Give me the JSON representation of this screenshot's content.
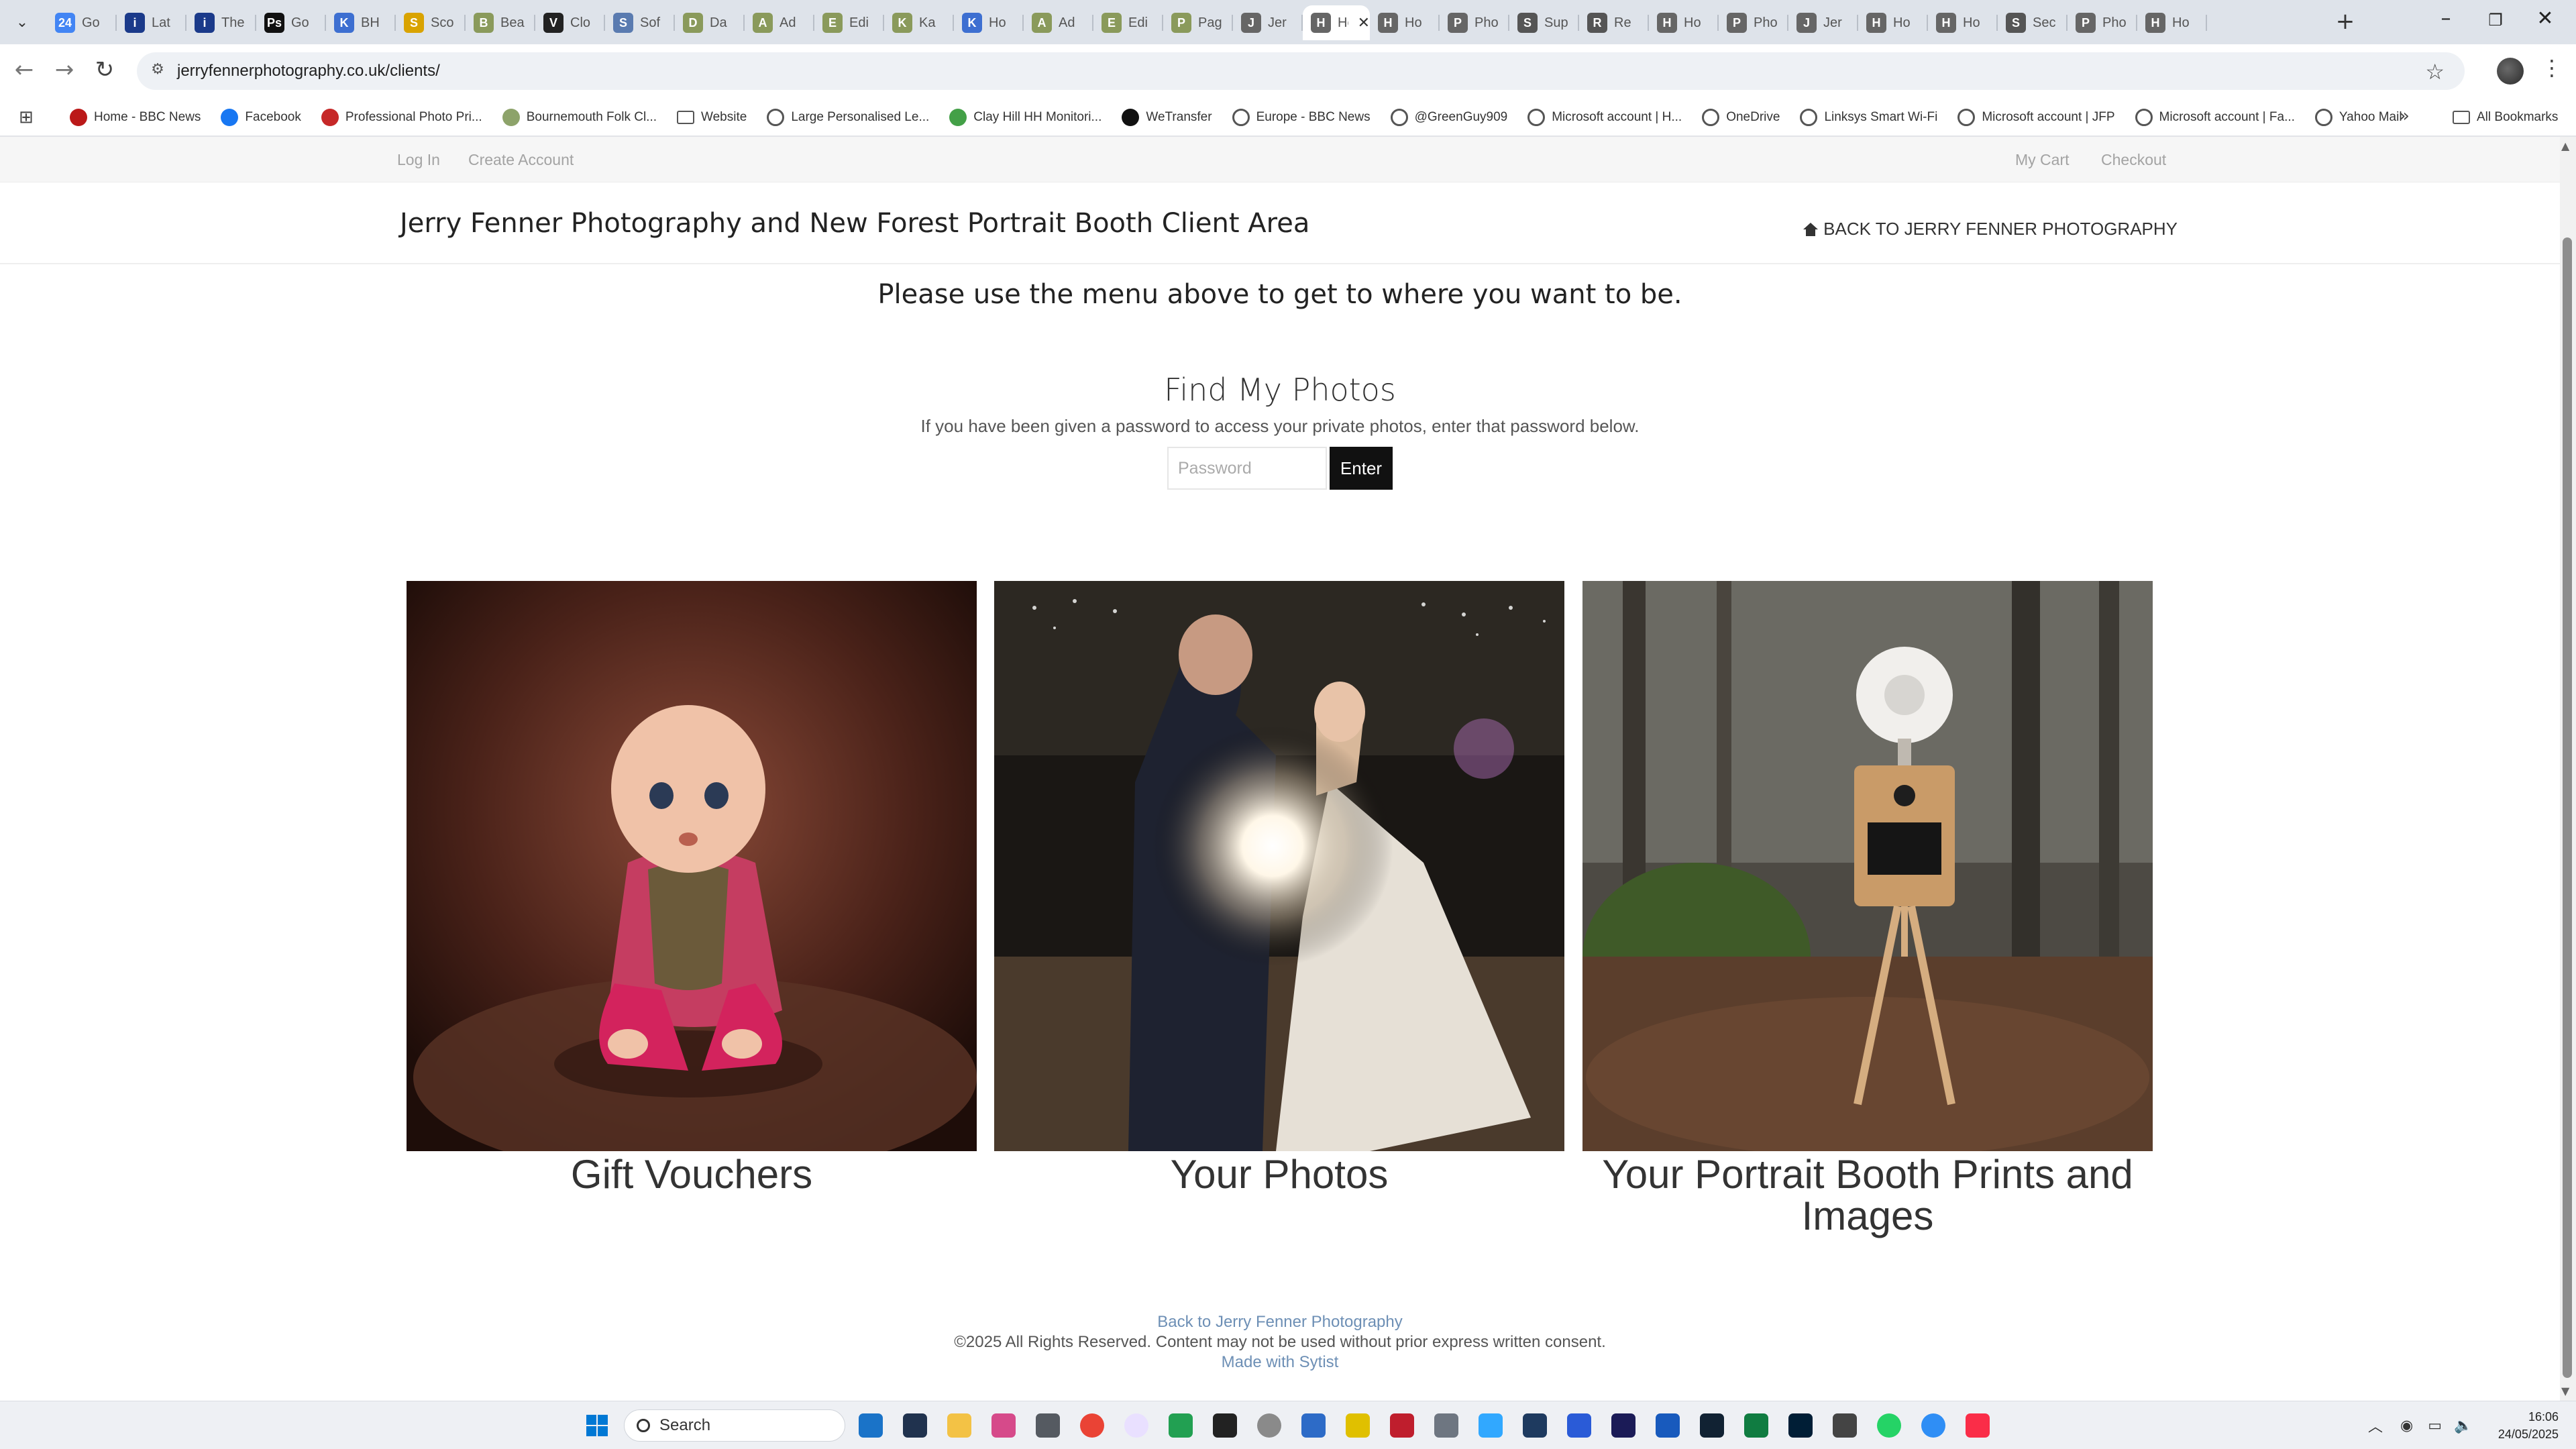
{
  "browser": {
    "tabs": [
      {
        "label": "Go",
        "color": "#4285f4",
        "glyph": "24"
      },
      {
        "label": "Lat",
        "color": "#1b3a8a",
        "glyph": "i"
      },
      {
        "label": "The",
        "color": "#1b3a8a",
        "glyph": "i"
      },
      {
        "label": "Go",
        "color": "#111111",
        "glyph": "Ps"
      },
      {
        "label": "BH",
        "color": "#3d6fd1",
        "glyph": "K"
      },
      {
        "label": "Sco",
        "color": "#d9a300",
        "glyph": "S"
      },
      {
        "label": "Bea",
        "color": "#8a9a5b",
        "glyph": "B"
      },
      {
        "label": "Clo",
        "color": "#222222",
        "glyph": "V"
      },
      {
        "label": "Sof",
        "color": "#5a7bb0",
        "glyph": "S"
      },
      {
        "label": "Da",
        "color": "#8a9a5b",
        "glyph": "D"
      },
      {
        "label": "Ad",
        "color": "#8a9a5b",
        "glyph": "A"
      },
      {
        "label": "Edi",
        "color": "#8a9a5b",
        "glyph": "E"
      },
      {
        "label": "Ka",
        "color": "#8a9a5b",
        "glyph": "K"
      },
      {
        "label": "Ho",
        "color": "#3d6fd1",
        "glyph": "K"
      },
      {
        "label": "Ad",
        "color": "#8a9a5b",
        "glyph": "A"
      },
      {
        "label": "Edi",
        "color": "#8a9a5b",
        "glyph": "E"
      },
      {
        "label": "Pag",
        "color": "#8a9a5b",
        "glyph": "P"
      },
      {
        "label": "Jer",
        "color": "#666666",
        "glyph": "J"
      },
      {
        "label": "Ho",
        "color": "#666666",
        "glyph": "H"
      },
      {
        "label": "Ho",
        "color": "#666666",
        "glyph": "H"
      },
      {
        "label": "Pho",
        "color": "#666666",
        "glyph": "P"
      },
      {
        "label": "Sup",
        "color": "#555555",
        "glyph": "S"
      },
      {
        "label": "Re",
        "color": "#555555",
        "glyph": "R"
      },
      {
        "label": "Ho",
        "color": "#666666",
        "glyph": "H"
      },
      {
        "label": "Pho",
        "color": "#666666",
        "glyph": "P"
      },
      {
        "label": "Jer",
        "color": "#666666",
        "glyph": "J"
      },
      {
        "label": "Ho",
        "color": "#666666",
        "glyph": "H"
      },
      {
        "label": "Ho",
        "color": "#666666",
        "glyph": "H"
      },
      {
        "label": "Sec",
        "color": "#555555",
        "glyph": "S"
      },
      {
        "label": "Pho",
        "color": "#666666",
        "glyph": "P"
      },
      {
        "label": "Ho",
        "color": "#666666",
        "glyph": "H"
      }
    ],
    "active_tab_index": 18,
    "url": "jerryfennerphotography.co.uk/clients/",
    "bookmarks": [
      {
        "label": "Home - BBC News",
        "color": "#bb1919",
        "icon": "bbc-news-icon"
      },
      {
        "label": "Facebook",
        "color": "#1877f2",
        "icon": "facebook-icon"
      },
      {
        "label": "Professional Photo Pri...",
        "color": "#c62828",
        "icon": "photo-print-icon"
      },
      {
        "label": "Bournemouth Folk Cl...",
        "color": "#8da36a",
        "icon": "folk-club-icon"
      },
      {
        "label": "Website",
        "color": "#ffffff",
        "icon": "folder-icon"
      },
      {
        "label": "Large Personalised Le...",
        "color": "#666666",
        "icon": "globe-icon"
      },
      {
        "label": "Clay Hill HH Monitori...",
        "color": "#43a047",
        "icon": "sheets-icon"
      },
      {
        "label": "WeTransfer",
        "color": "#111111",
        "icon": "wetransfer-icon"
      },
      {
        "label": "Europe - BBC News",
        "color": "#666666",
        "icon": "globe-icon"
      },
      {
        "label": "@GreenGuy909",
        "color": "#666666",
        "icon": "globe-icon"
      },
      {
        "label": "Microsoft account | H...",
        "color": "#666666",
        "icon": "globe-icon"
      },
      {
        "label": "OneDrive",
        "color": "#666666",
        "icon": "globe-icon"
      },
      {
        "label": "Linksys Smart Wi-Fi",
        "color": "#666666",
        "icon": "globe-icon"
      },
      {
        "label": "Microsoft account | JFP",
        "color": "#666666",
        "icon": "globe-icon"
      },
      {
        "label": "Microsoft account | Fa...",
        "color": "#666666",
        "icon": "globe-icon"
      },
      {
        "label": "Yahoo Mail",
        "color": "#666666",
        "icon": "globe-icon"
      }
    ],
    "all_bookmarks_label": "All Bookmarks"
  },
  "page": {
    "topbar": {
      "login": "Log In",
      "create_account": "Create Account",
      "cart": "My Cart",
      "checkout": "Checkout"
    },
    "site_title": "Jerry Fenner Photography and New Forest Portrait Booth Client Area",
    "back_link": "BACK TO JERRY FENNER PHOTOGRAPHY",
    "menu_note": "Please use the menu above to get to where you want to be.",
    "find": {
      "title": "Find My Photos",
      "description": "If you have been given a password to access your private photos, enter that password below.",
      "placeholder": "Password",
      "button": "Enter"
    },
    "cards": [
      {
        "caption": "Gift Vouchers"
      },
      {
        "caption": "Your Photos"
      },
      {
        "caption": "Your Portrait Booth Prints and Images"
      }
    ],
    "footer": {
      "back_link": "Back to Jerry Fenner Photography",
      "copyright": "©2025 All Rights Reserved. Content may not be used without prior express written consent.",
      "made_with": "Made with Sytist"
    }
  },
  "taskbar": {
    "search_label": "Search",
    "time": "16:06",
    "date": "24/05/2025"
  }
}
